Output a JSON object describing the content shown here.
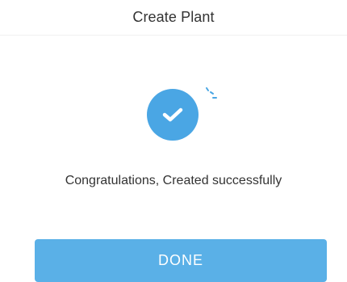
{
  "header": {
    "title": "Create Plant"
  },
  "status": {
    "icon": "success-check-icon",
    "decoration_icon": "sparkle-icon",
    "message": "Congratulations, Created successfully"
  },
  "actions": {
    "done_label": "DONE"
  },
  "colors": {
    "accent": "#4aa6e4",
    "button": "#5ab0e7",
    "text": "#333333",
    "divider": "#f0f0f0"
  }
}
